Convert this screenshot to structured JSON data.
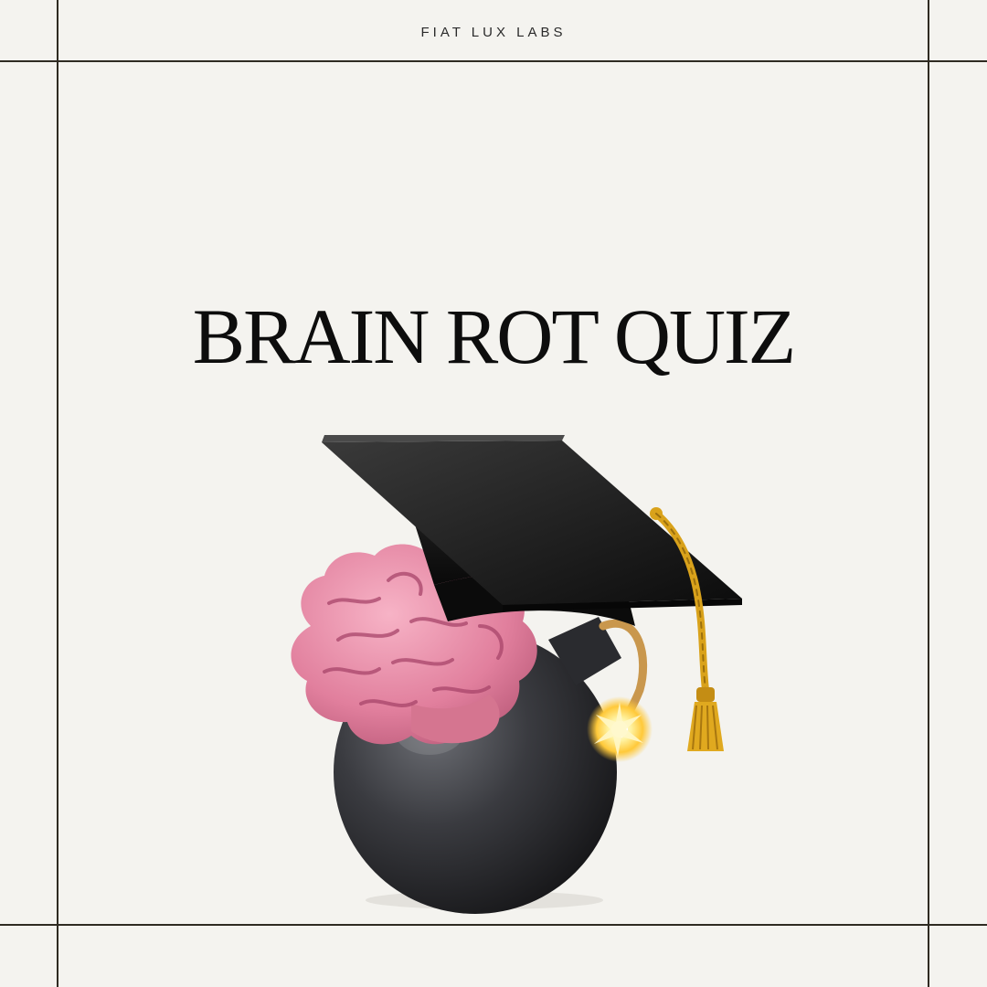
{
  "header": {
    "brand": "FIAT LUX LABS"
  },
  "main": {
    "title": "BRAIN  ROT QUIZ"
  },
  "illustration": {
    "icons": [
      "bomb-icon",
      "brain-icon",
      "graduation-cap-icon",
      "tassel-icon",
      "spark-icon"
    ],
    "colors": {
      "background": "#f4f3ef",
      "rule": "#2f2b22",
      "bomb": "#2e2f33",
      "brain": "#e48aa6",
      "cap": "#151515",
      "tassel": "#d9a21b",
      "spark": "#ffd84a"
    }
  }
}
